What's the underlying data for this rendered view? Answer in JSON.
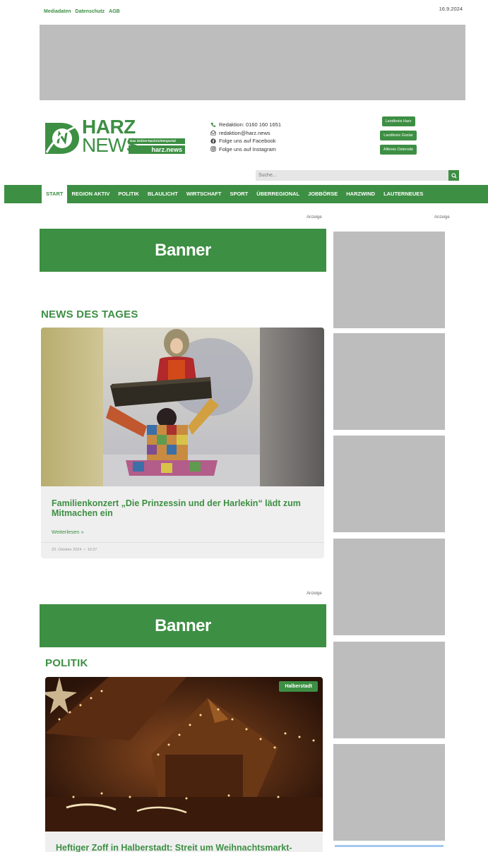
{
  "topbar": {
    "links": [
      "Mediadaten",
      "Datenschutz",
      "AGB"
    ],
    "date": "16.9.2024"
  },
  "logo": {
    "harz": "HARZ",
    "news": "NEWS",
    "tagline": "Das Online-Nachrichtenportal",
    "domain": "harz.news"
  },
  "contact": {
    "redaktion_phone": "Redaktion: 0160 160 1651",
    "email": "redaktion@harz.news",
    "facebook": "Folge uns auf Facebook",
    "instagram": "Folge uns auf Instagram"
  },
  "regions": [
    "Landkreis Harz",
    "Landkreis Goslar",
    "Altkreis Osterode"
  ],
  "search": {
    "placeholder": "Suche..."
  },
  "nav": [
    "START",
    "REGION AKTIV",
    "POLITIK",
    "BLAULICHT",
    "WIRTSCHAFT",
    "SPORT",
    "ÜBERREGIONAL",
    "JOBBÖRSE",
    "HARZWIND",
    "LAUTERNEUES"
  ],
  "ads": {
    "label": "Anzeige",
    "banner": "Banner"
  },
  "news_des_tages": {
    "heading": "NEWS DES TAGES",
    "title": "Familienkonzert „Die Prinzessin und der Harlekin“ lädt zum Mitmachen ein",
    "read_more": "Weiterlesen »",
    "date": "23. Oktober 2024",
    "time": "10:27"
  },
  "politik": {
    "heading": "POLITIK",
    "badge": "Halberstadt",
    "title": "Heftiger Zoff in Halberstadt: Streit um Weihnachtsmarkt-"
  },
  "colors": {
    "brand": "#3d8f43",
    "ad_placeholder": "#bdbdbd"
  }
}
